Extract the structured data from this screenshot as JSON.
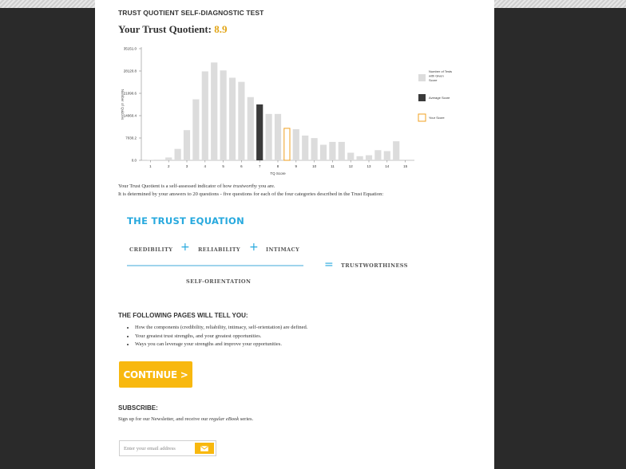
{
  "header": {
    "test_title": "TRUST QUOTIENT SELF-DIAGNOSTIC TEST",
    "tq_label": "Your Trust Quotient:",
    "tq_value": "8.9"
  },
  "chart_data": {
    "type": "bar",
    "ylabel": "Number of Quizzes",
    "xlabel": "TQ Score",
    "y_ticks": [
      "35151.0",
      "28120.8",
      "21090.6",
      "14060.4",
      "7030.2",
      "0.0"
    ],
    "ylim": [
      0,
      35151.0
    ],
    "x_ticks": [
      "1",
      "2",
      "3",
      "4",
      "5",
      "6",
      "7",
      "8",
      "9",
      "10",
      "11",
      "12",
      "13",
      "14",
      "15"
    ],
    "values": [
      80,
      200,
      900,
      3600,
      9500,
      19200,
      28000,
      30800,
      28300,
      26000,
      24700,
      19900,
      17600,
      14600,
      14600,
      10200,
      9800,
      7800,
      7000,
      4900,
      5800,
      5800,
      2400,
      1300,
      1600,
      3200,
      2900,
      6000
    ],
    "x": [
      1.0,
      1.5,
      2.0,
      2.5,
      3.0,
      3.5,
      4.0,
      4.5,
      5.0,
      5.5,
      6.0,
      6.5,
      7.0,
      7.5,
      8.0,
      8.5,
      9.0,
      9.5,
      10.0,
      10.5,
      11.0,
      11.5,
      12.0,
      12.5,
      13.0,
      13.5,
      14.0,
      14.5
    ],
    "average_score": 7.0,
    "your_score": 8.5,
    "legend": [
      {
        "label": "Number of Tests with Given Score",
        "color": "#dcdcdc"
      },
      {
        "label": "Average Score",
        "color": "#3a3a3a"
      },
      {
        "label": "Your Score",
        "color": "#f0a020"
      }
    ],
    "legend_position": "right",
    "colors": {
      "bar": "#dcdcdc",
      "average": "#3a3a3a",
      "your_score": "#f0a020"
    }
  },
  "intro": {
    "line1_prefix": "Your Trust Quotient is a self-assessed indicator of how ",
    "line1_italic": "trustworthy",
    "line1_suffix": " you are.",
    "line2": "It is determined by your answers to 20 questions - five questions for each of the four categories described in the Trust Equation:"
  },
  "equation": {
    "title": "THE TRUST EQUATION",
    "term1": "CREDIBILITY",
    "term2": "RELIABILITY",
    "term3": "INTIMACY",
    "plus": "+",
    "equals": "=",
    "result": "TRUSTWORTHINESS",
    "denominator": "SELF-ORIENTATION"
  },
  "pages_info": {
    "heading": "THE FOLLOWING PAGES WILL TELL YOU:",
    "items": [
      "How the components (credibility, reliability, intimacy, self-orientation) are defined.",
      "Your greatest trust strengths, and your greatest opportunities.",
      "Ways you can leverage your strengths and improve your opportunities."
    ]
  },
  "continue_button": {
    "label": "CONTINUE >"
  },
  "subscribe": {
    "heading": "SUBSCRIBE:",
    "text_prefix": "Sign up for our Newsletter, and receive our ",
    "text_italic": "regular eBook",
    "text_suffix": " series.",
    "email_placeholder": "Enter your email address",
    "submit_icon": "mail-icon"
  },
  "colors": {
    "accent": "#f8b80f",
    "brand_blue": "#27a9de",
    "tq_value": "#e2a517"
  }
}
